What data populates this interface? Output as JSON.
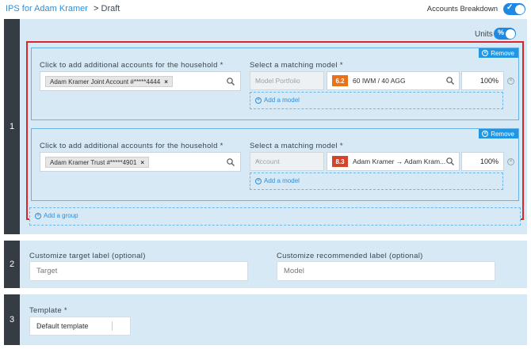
{
  "header": {
    "link_text": "IPS for Adam Kramer",
    "crumb_sep": ">",
    "status": "Draft",
    "accounts_breakdown_label": "Accounts Breakdown",
    "accounts_breakdown_on": true
  },
  "section1": {
    "number": "1",
    "units_label": "Units",
    "units_toggle_text": "%",
    "groups": [
      {
        "remove_label": "Remove",
        "accounts_label": "Click to add additional accounts for the household *",
        "account_chip": "Adam Kramer Joint Account #*****4444",
        "chip_remove": "×",
        "model_label": "Select a matching model *",
        "model_type": "Model Portfolio",
        "model_badge": "6.2",
        "model_badge_color": "#e8711a",
        "model_name": "60 IWM / 40 AGG",
        "percent": "100%",
        "add_model": "Add a model"
      },
      {
        "remove_label": "Remove",
        "accounts_label": "Click to add additional accounts for the household *",
        "account_chip": "Adam Kramer Trust #*****4901",
        "chip_remove": "×",
        "model_label": "Select a matching model *",
        "model_type": "Account",
        "model_badge": "8.3",
        "model_badge_color": "#d2452c",
        "model_name": "Adam Kramer → Adam Kram...",
        "percent": "100%",
        "add_model": "Add a model"
      }
    ],
    "add_group": "Add a group"
  },
  "section2": {
    "number": "2",
    "target_label": "Customize target label (optional)",
    "target_placeholder": "Target",
    "recommended_label": "Customize recommended label (optional)",
    "recommended_placeholder": "Model"
  },
  "section3": {
    "number": "3",
    "template_label": "Template *",
    "template_value": "Default template"
  },
  "colors": {
    "accent": "#1e88e5",
    "panel": "#d6e9f5",
    "highlight_border": "#d9262c",
    "step_sidebar": "#353c44"
  }
}
